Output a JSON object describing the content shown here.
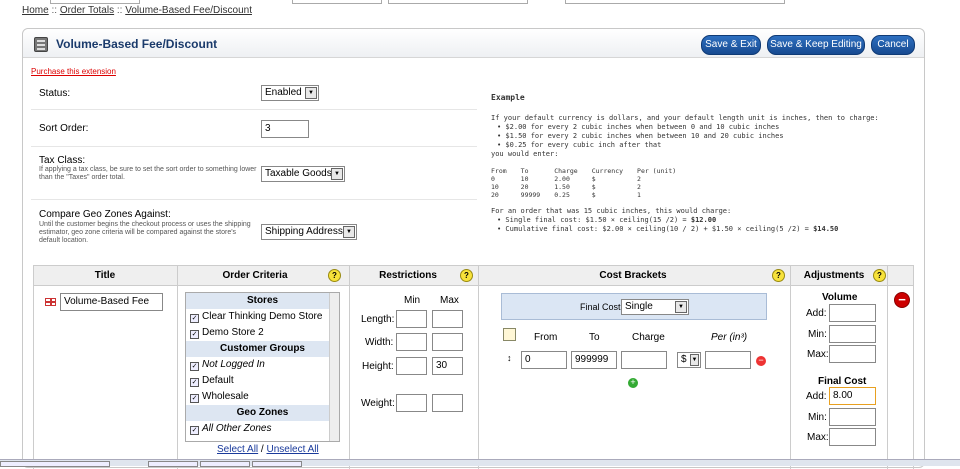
{
  "breadcrumb": {
    "items": [
      "Home",
      "Order Totals",
      "Volume-Based Fee/Discount"
    ],
    "sep": "::"
  },
  "header": {
    "title": "Volume-Based Fee/Discount",
    "save_exit": "Save & Exit",
    "save_keep": "Save & Keep Editing",
    "cancel": "Cancel"
  },
  "purchase_link": "Purchase this extension",
  "form": {
    "status": {
      "label": "Status:",
      "value": "Enabled"
    },
    "sort_order": {
      "label": "Sort Order:",
      "value": "3"
    },
    "tax_class": {
      "label": "Tax Class:",
      "help": "If applying a tax class, be sure to set the sort order to something lower than the \"Taxes\" order total.",
      "value": "Taxable Goods"
    },
    "geo_zones": {
      "label": "Compare Geo Zones Against:",
      "help": "Until the customer begins the checkout process or uses the shipping estimator, geo zone criteria will be compared against the store's default location.",
      "value": "Shipping Address"
    }
  },
  "example": {
    "heading": "Example",
    "intro": "If your default currency is dollars, and your default length unit is inches, then to charge:",
    "bullets": [
      "• $2.00 for every 2 cubic inches when between 0 and 10 cubic inches",
      "• $1.50 for every 2 cubic inches when between 10 and 20 cubic inches",
      "• $0.25 for every cubic inch after that"
    ],
    "enter": "you would enter:",
    "table_head": [
      "From",
      "To",
      "Charge",
      "Currency",
      "Per (unit)"
    ],
    "table_rows": [
      [
        "0",
        "10",
        "2.00",
        "$",
        "2"
      ],
      [
        "10",
        "20",
        "1.50",
        "$",
        "2"
      ],
      [
        "20",
        "99999",
        "0.25",
        "$",
        "1"
      ]
    ],
    "order_line": "For an order that was 15 cubic inches, this would charge:",
    "single_text": "• Single final cost: $1.50 × ceiling(15 /2) = ",
    "single_total": "$12.00",
    "cumulative_text": "• Cumulative final cost: $2.00 × ceiling(10 / 2) + $1.50 × ceiling(5 /2) = ",
    "cumulative_total": "$14.50"
  },
  "grid": {
    "headers": {
      "title": "Title",
      "criteria": "Order Criteria",
      "restrictions": "Restrictions",
      "brackets": "Cost Brackets",
      "adjustments": "Adjustments"
    },
    "help_glyph": "?",
    "title_value": "Volume-Based Fee",
    "stores_list": [
      {
        "type": "group",
        "label": "Stores"
      },
      {
        "type": "option",
        "label": "Clear Thinking Demo Store",
        "checked": true
      },
      {
        "type": "option",
        "label": "Demo Store 2",
        "checked": true
      },
      {
        "type": "group",
        "label": "Customer Groups"
      },
      {
        "type": "option",
        "label": "Not Logged In",
        "checked": true,
        "italic": true
      },
      {
        "type": "option",
        "label": "Default",
        "checked": true
      },
      {
        "type": "option",
        "label": "Wholesale",
        "checked": true
      },
      {
        "type": "group",
        "label": "Geo Zones"
      },
      {
        "type": "option",
        "label": "All Other Zones",
        "checked": true,
        "italic": true
      }
    ],
    "select_all": "Select All",
    "unselect_all": "Unselect All",
    "select_sep": "/",
    "restrictions": {
      "min": "Min",
      "max": "Max",
      "length": "Length:",
      "width": "Width:",
      "height": "Height:",
      "height_max": "30",
      "weight": "Weight:"
    },
    "brackets": {
      "final_cost_label": "Final Cost:",
      "final_cost_value": "Single",
      "from": "From",
      "to": "To",
      "charge": "Charge",
      "per": "Per (in³)",
      "from_value": "0",
      "to_value": "999999",
      "currency": "$"
    },
    "adjustments": {
      "volume": "Volume",
      "final_cost": "Final Cost",
      "add": "Add:",
      "min": "Min:",
      "max": "Max:",
      "final_add_value": "8.00"
    }
  }
}
